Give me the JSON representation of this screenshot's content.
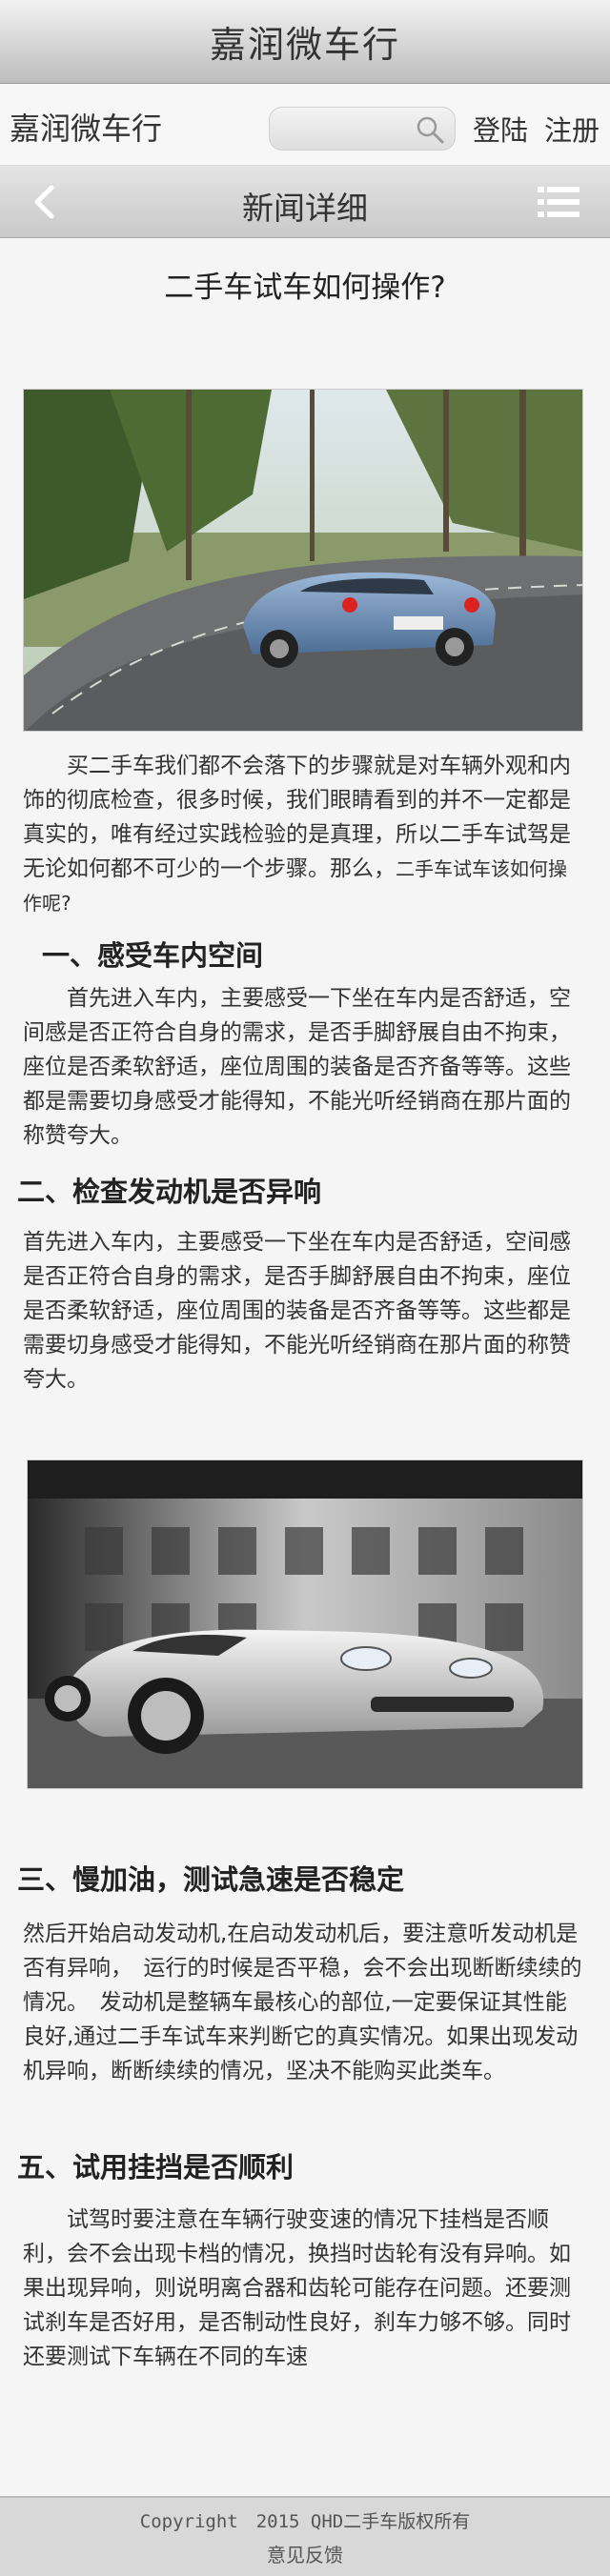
{
  "topbar": {
    "title": "嘉润微车行"
  },
  "header": {
    "brand": "嘉润微车行",
    "search": {
      "placeholder": "",
      "icon": "search-icon"
    },
    "login": "登陆",
    "register": "注册"
  },
  "navbar": {
    "title": "新闻详细",
    "back_icon": "chevron-left-icon",
    "menu_icon": "menu-icon"
  },
  "article": {
    "title": "二手车试车如何操作?",
    "intro_main": "买二手车我们都不会落下的步骤就是对车辆外观和内饰的彻底检查，很多时候，我们眼睛看到的并不一定都是真实的，唯有经过实践检验的是真理，所以二手车试驾是无论如何都不可少的一个步骤。那么，",
    "intro_small": "二手车试车该如何操作呢?",
    "sections": [
      {
        "heading": "一、感受车内空间",
        "text": "首先进入车内，主要感受一下坐在车内是否舒适，空间感是否正符合自身的需求，是否手脚舒展自由不拘束，座位是否柔软舒适，座位周围的装备是否齐备等等。这些都是需要切身感受才能得知，不能光听经销商在那片面的称赞夸大。"
      },
      {
        "heading": "二、检查发动机是否异响",
        "text": "首先进入车内，主要感受一下坐在车内是否舒适，空间感是否正符合自身的需求，是否手脚舒展自由不拘束，座位是否柔软舒适，座位周围的装备是否齐备等等。这些都是需要切身感受才能得知，不能光听经销商在那片面的称赞夸大。"
      },
      {
        "heading": "三、慢加油，测试急速是否稳定",
        "text": "然后开始启动发动机,在启动发动机后，要注意听发动机是否有异响，　运行的时候是否平稳，会不会出现断断续续的情况。　发动机是整辆车最核心的部位,一定要保证其性能良好,通过二手车试车来判断它的真实情况。如果出现发动机异响，断断续续的情况，坚决不能购买此类车。"
      },
      {
        "heading": "五、试用挂挡是否顺利",
        "text": "试驾时要注意在车辆行驶变速的情况下挂档是否顺利，会不会出现卡档的情况，换挡时齿轮有没有异响。如果出现异响，则说明离合器和齿轮可能存在问题。还要测试刹车是否好用，是否制动性良好，刹车力够不够。同时还要测试下车辆在不同的车速"
      }
    ]
  },
  "footer": {
    "copyright": "Copyright　2015 QHD二手车版权所有",
    "feedback": "意见反馈"
  },
  "colors": {
    "background": "#f5f5f5",
    "footer": "#d8d8d8",
    "text": "#333333"
  }
}
